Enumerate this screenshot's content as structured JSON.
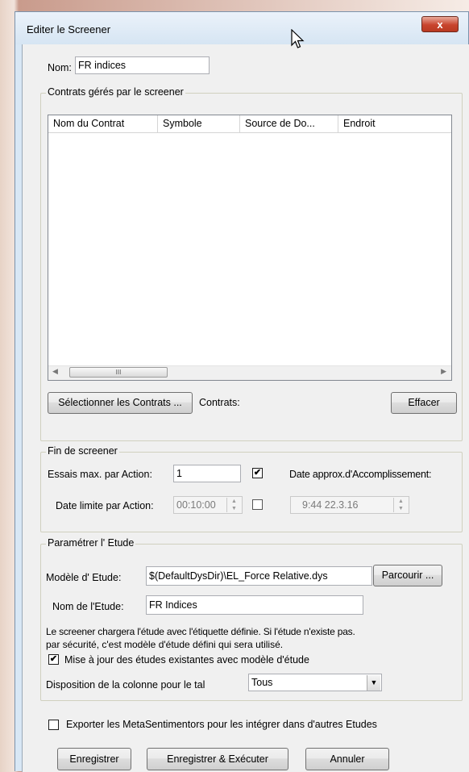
{
  "window": {
    "title": "Editer le Screener",
    "close_label": "x"
  },
  "name_field": {
    "label": "Nom:",
    "value": "FR indices"
  },
  "contracts_group": {
    "legend": "Contrats gérés par le screener",
    "columns": [
      "Nom du Contrat",
      "Symbole",
      "Source de Do...",
      "Endroit"
    ],
    "scroll_thumb": "III",
    "select_button": "Sélectionner les Contrats ...",
    "contracts_label": "Contrats:",
    "clear_button": "Effacer"
  },
  "end_group": {
    "legend": "Fin de screener",
    "max_tries_label": "Essais max. par Action:",
    "max_tries_value": "1",
    "max_tries_checked": true,
    "completion_date_label": "Date approx.d'Accomplissement:",
    "deadline_label": "Date limite par Action:",
    "deadline_value": "00:10:00",
    "deadline_checked": false,
    "completion_value": "9:44   22.3.16"
  },
  "study_group": {
    "legend": "Paramétrer l' Etude",
    "model_label": "Modèle d' Etude:",
    "model_value": "$(DefaultDysDir)\\EL_Force Relative.dys",
    "browse_button": "Parcourir ...",
    "study_name_label": "Nom de l'Etude:",
    "study_name_value": "FR Indices",
    "info_line1": "Le screener chargera l'étude avec l'étiquette définie. Si l'étude n'existe pas.",
    "info_line2": "par sécurité, c'est modèle d'étude défini qui sera utilisé.",
    "update_label": "Mise à jour des études existantes avec modèle d'étude",
    "update_checked": true,
    "column_layout_label": "Disposition de la colonne pour le tal",
    "column_layout_value": "Tous"
  },
  "export": {
    "label": "Exporter les MetaSentimentors pour les intégrer dans d'autres Etudes",
    "checked": false
  },
  "buttons": {
    "save": "Enregistrer",
    "save_run": "Enregistrer & Exécuter",
    "cancel": "Annuler"
  }
}
